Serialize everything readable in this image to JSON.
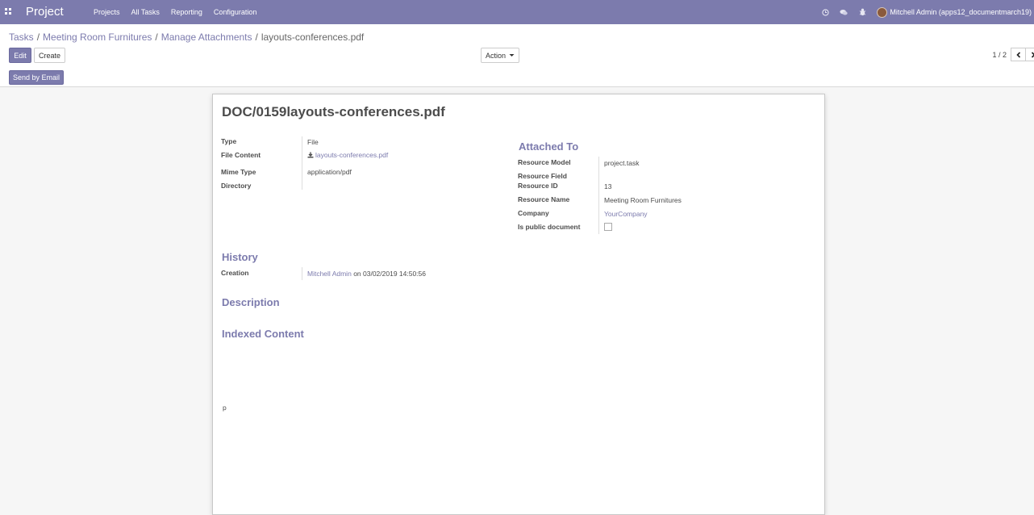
{
  "navbar": {
    "brand": "Project",
    "menu": [
      "Projects",
      "All Tasks",
      "Reporting",
      "Configuration"
    ],
    "user": "Mitchell Admin (apps12_documentmarch19)"
  },
  "breadcrumb": [
    "Tasks",
    "Meeting Room Furnitures",
    "Manage Attachments",
    "layouts-conferences.pdf"
  ],
  "buttons": {
    "edit": "Edit",
    "create": "Create",
    "action": "Action",
    "send_email": "Send by Email"
  },
  "pager": "1 / 2",
  "record": {
    "title": "DOC/0159layouts-conferences.pdf",
    "fields": {
      "type_label": "Type",
      "type_value": "File",
      "content_label": "File Content",
      "content_value": "layouts-conferences.pdf",
      "mime_label": "Mime Type",
      "mime_value": "application/pdf",
      "directory_label": "Directory"
    },
    "attached": {
      "heading": "Attached To",
      "model_label": "Resource Model",
      "model_value": "project.task",
      "field_label": "Resource Field",
      "id_label": "Resource ID",
      "id_value": "13",
      "name_label": "Resource Name",
      "name_value": "Meeting Room Furnitures",
      "company_label": "Company",
      "company_value": "YourCompany",
      "public_label": "Is public document"
    },
    "history": {
      "heading": "History",
      "creation_label": "Creation",
      "creation_user": "Mitchell Admin",
      "creation_date": "on 03/02/2019 14:50:56"
    },
    "description_heading": "Description",
    "indexed_heading": "Indexed Content",
    "indexed_text": "p"
  }
}
